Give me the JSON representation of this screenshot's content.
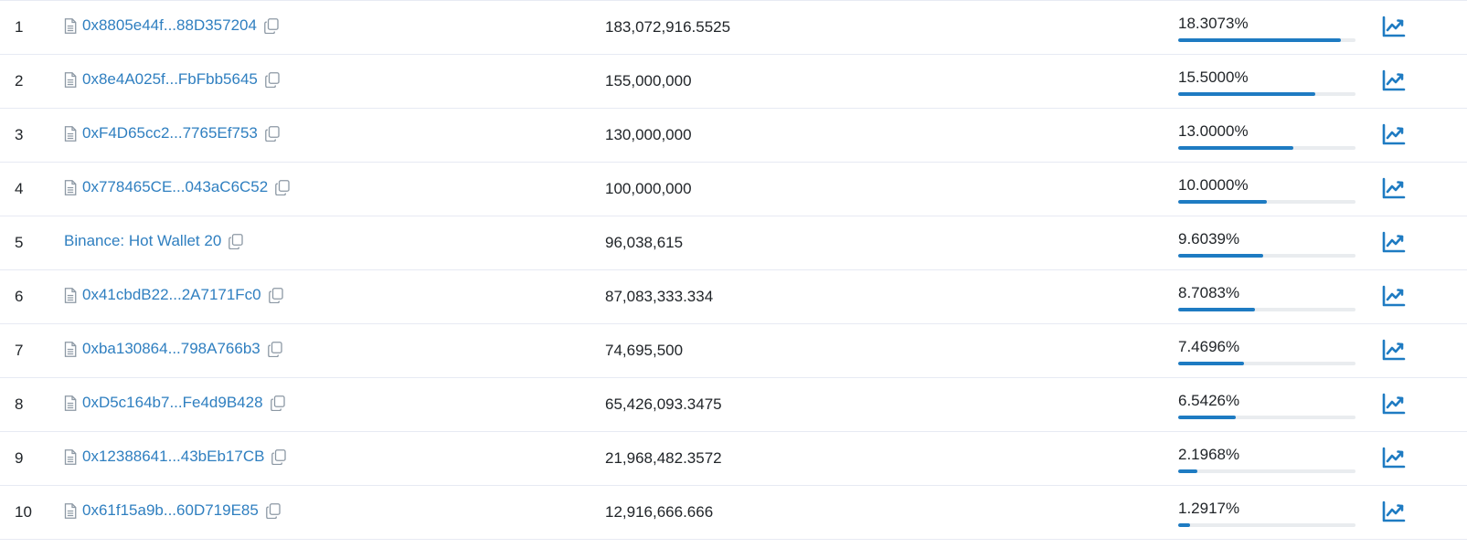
{
  "icons": {
    "contract": "contract-document-icon",
    "copy": "copy-icon",
    "analytics": "line-chart-icon"
  },
  "colors": {
    "link": "#2f7fc0",
    "bar": "#1e7bc2",
    "bar_track": "#e9ecef",
    "divider": "#e7eaf3"
  },
  "holders": [
    {
      "rank": "1",
      "address": "0x8805e44f...88D357204",
      "is_contract": true,
      "quantity": "183,072,916.5525",
      "percentage": "18.3073%",
      "share": 18.3073
    },
    {
      "rank": "2",
      "address": "0x8e4A025f...FbFbb5645",
      "is_contract": true,
      "quantity": "155,000,000",
      "percentage": "15.5000%",
      "share": 15.5
    },
    {
      "rank": "3",
      "address": "0xF4D65cc2...7765Ef753",
      "is_contract": true,
      "quantity": "130,000,000",
      "percentage": "13.0000%",
      "share": 13.0
    },
    {
      "rank": "4",
      "address": "0x778465CE...043aC6C52",
      "is_contract": true,
      "quantity": "100,000,000",
      "percentage": "10.0000%",
      "share": 10.0
    },
    {
      "rank": "5",
      "address": "Binance: Hot Wallet 20",
      "is_contract": false,
      "quantity": "96,038,615",
      "percentage": "9.6039%",
      "share": 9.6039
    },
    {
      "rank": "6",
      "address": "0x41cbdB22...2A7171Fc0",
      "is_contract": true,
      "quantity": "87,083,333.334",
      "percentage": "8.7083%",
      "share": 8.7083
    },
    {
      "rank": "7",
      "address": "0xba130864...798A766b3",
      "is_contract": true,
      "quantity": "74,695,500",
      "percentage": "7.4696%",
      "share": 7.4696
    },
    {
      "rank": "8",
      "address": "0xD5c164b7...Fe4d9B428",
      "is_contract": true,
      "quantity": "65,426,093.3475",
      "percentage": "6.5426%",
      "share": 6.5426
    },
    {
      "rank": "9",
      "address": "0x12388641...43bEb17CB",
      "is_contract": true,
      "quantity": "21,968,482.3572",
      "percentage": "2.1968%",
      "share": 2.1968
    },
    {
      "rank": "10",
      "address": "0x61f15a9b...60D719E85",
      "is_contract": true,
      "quantity": "12,916,666.666",
      "percentage": "1.2917%",
      "share": 1.2917
    }
  ]
}
